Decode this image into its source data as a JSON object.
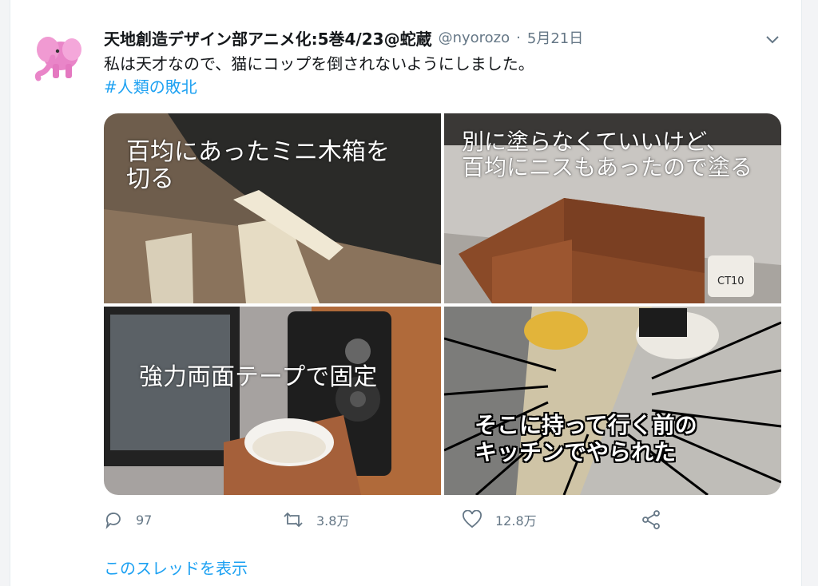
{
  "tweet": {
    "author_name": "天地創造デザイン部アニメ化:5巻4/23@蛇蔵",
    "handle": "@nyorozo",
    "separator": "·",
    "date": "5月21日",
    "text": "私は天才なので、猫にコップを倒されないようにしました。",
    "hashtag": "#人類の敗北"
  },
  "media": {
    "panels": [
      {
        "caption_lines": [
          "百均にあったミニ木箱を",
          "切る"
        ]
      },
      {
        "caption_lines": [
          "別に塗らなくていいけど、",
          "百均にニスもあったので塗る"
        ]
      },
      {
        "caption_lines": [
          "強力両面テープで固定"
        ]
      },
      {
        "caption_lines": [
          "そこに持って行く前の",
          "キッチンでやられた"
        ]
      }
    ],
    "cup_label": "CT10"
  },
  "actions": {
    "reply_count": "97",
    "retweet_count": "3.8万",
    "like_count": "12.8万"
  },
  "thread_link": "このスレッドを表示",
  "icons": [
    "elephant-avatar-icon",
    "chevron-down-icon",
    "reply-icon",
    "retweet-icon",
    "like-icon",
    "share-icon"
  ],
  "colors": {
    "link": "#1da1f2",
    "muted": "#657786",
    "text": "#14171a"
  }
}
